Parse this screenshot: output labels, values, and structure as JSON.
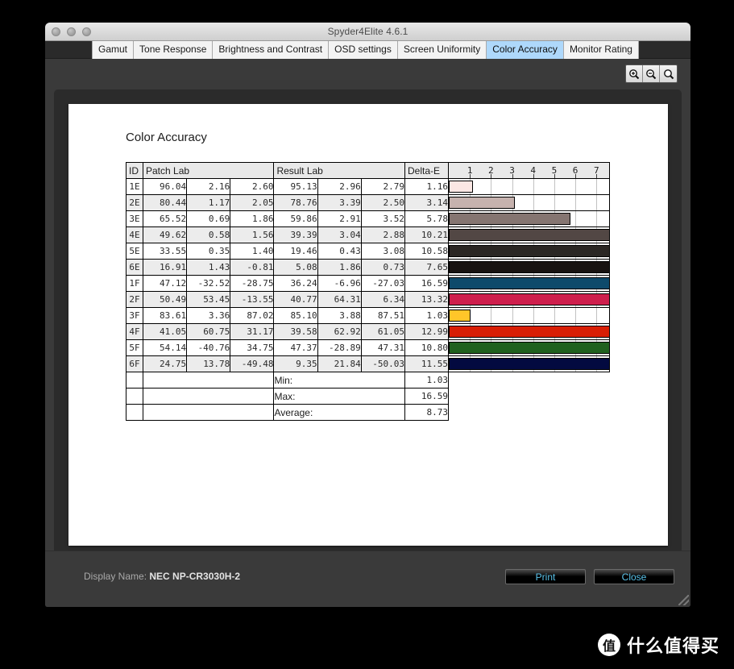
{
  "window": {
    "title": "Spyder4Elite 4.6.1",
    "traffic_lights": [
      "close-button",
      "minimize-button",
      "zoom-button"
    ]
  },
  "tabs": [
    {
      "label": "Gamut",
      "active": false
    },
    {
      "label": "Tone Response",
      "active": false
    },
    {
      "label": "Brightness and Contrast",
      "active": false
    },
    {
      "label": "OSD settings",
      "active": false
    },
    {
      "label": "Screen Uniformity",
      "active": false
    },
    {
      "label": "Color Accuracy",
      "active": true
    },
    {
      "label": "Monitor Rating",
      "active": false
    }
  ],
  "toolbar": {
    "zoom_in_icon": "zoom-in-icon",
    "zoom_out_icon": "zoom-out-icon",
    "zoom_reset_icon": "magnifier-icon"
  },
  "report": {
    "title": "Color Accuracy",
    "headers": {
      "id": "ID",
      "patch_lab": "Patch Lab",
      "result_lab": "Result Lab",
      "delta_e": "Delta-E"
    },
    "scale_ticks": [
      "1",
      "2",
      "3",
      "4",
      "5",
      "6",
      "7"
    ],
    "scale_max": 7.6,
    "rows": [
      {
        "id": "1E",
        "patch": [
          "96.04",
          "2.16",
          "2.60"
        ],
        "result": [
          "95.13",
          "2.96",
          "2.79"
        ],
        "delta_e": "1.16",
        "bar_value": 1.16,
        "color": "#fbe7e4"
      },
      {
        "id": "2E",
        "patch": [
          "80.44",
          "1.17",
          "2.05"
        ],
        "result": [
          "78.76",
          "3.39",
          "2.50"
        ],
        "delta_e": "3.14",
        "bar_value": 3.14,
        "color": "#c6b2ae"
      },
      {
        "id": "3E",
        "patch": [
          "65.52",
          "0.69",
          "1.86"
        ],
        "result": [
          "59.86",
          "2.91",
          "3.52"
        ],
        "delta_e": "5.78",
        "bar_value": 5.78,
        "color": "#857571"
      },
      {
        "id": "4E",
        "patch": [
          "49.62",
          "0.58",
          "1.56"
        ],
        "result": [
          "39.39",
          "3.04",
          "2.88"
        ],
        "delta_e": "10.21",
        "bar_value": 10.21,
        "color": "#524744"
      },
      {
        "id": "5E",
        "patch": [
          "33.55",
          "0.35",
          "1.40"
        ],
        "result": [
          "19.46",
          "0.43",
          "3.08"
        ],
        "delta_e": "10.58",
        "bar_value": 10.58,
        "color": "#2b2724"
      },
      {
        "id": "6E",
        "patch": [
          "16.91",
          "1.43",
          "-0.81"
        ],
        "result": [
          "5.08",
          "1.86",
          "0.73"
        ],
        "delta_e": "7.65",
        "bar_value": 7.65,
        "color": "#181311"
      },
      {
        "id": "1F",
        "patch": [
          "47.12",
          "-32.52",
          "-28.75"
        ],
        "result": [
          "36.24",
          "-6.96",
          "-27.03"
        ],
        "delta_e": "16.59",
        "bar_value": 16.59,
        "color": "#0e4a6b"
      },
      {
        "id": "2F",
        "patch": [
          "50.49",
          "53.45",
          "-13.55"
        ],
        "result": [
          "40.77",
          "64.31",
          "6.34"
        ],
        "delta_e": "13.32",
        "bar_value": 13.32,
        "color": "#ce1f4d"
      },
      {
        "id": "3F",
        "patch": [
          "83.61",
          "3.36",
          "87.02"
        ],
        "result": [
          "85.10",
          "3.88",
          "87.51"
        ],
        "delta_e": "1.03",
        "bar_value": 1.03,
        "color": "#ffc629"
      },
      {
        "id": "4F",
        "patch": [
          "41.05",
          "60.75",
          "31.17"
        ],
        "result": [
          "39.58",
          "62.92",
          "61.05"
        ],
        "delta_e": "12.99",
        "bar_value": 12.99,
        "color": "#d81e05"
      },
      {
        "id": "5F",
        "patch": [
          "54.14",
          "-40.76",
          "34.75"
        ],
        "result": [
          "47.37",
          "-28.89",
          "47.31"
        ],
        "delta_e": "10.80",
        "bar_value": 10.8,
        "color": "#20611f"
      },
      {
        "id": "6F",
        "patch": [
          "24.75",
          "13.78",
          "-49.48"
        ],
        "result": [
          "9.35",
          "21.84",
          "-50.03"
        ],
        "delta_e": "11.55",
        "bar_value": 11.55,
        "color": "#030a40"
      }
    ],
    "summary": [
      {
        "label": "Min:",
        "value": "1.03"
      },
      {
        "label": "Max:",
        "value": "16.59"
      },
      {
        "label": "Average:",
        "value": "8.73"
      }
    ]
  },
  "footer": {
    "display_name_label": "Display Name:",
    "display_name_value": "NEC NP-CR3030H-2",
    "print_label": "Print",
    "close_label": "Close"
  },
  "watermark": {
    "badge": "值",
    "text": "什么值得买"
  },
  "chart_data": {
    "type": "bar",
    "title": "Color Accuracy",
    "xlabel": "Delta-E",
    "ylabel": "Patch ID",
    "categories": [
      "1E",
      "2E",
      "3E",
      "4E",
      "5E",
      "6E",
      "1F",
      "2F",
      "3F",
      "4F",
      "5F",
      "6F"
    ],
    "values": [
      1.16,
      3.14,
      5.78,
      10.21,
      10.58,
      7.65,
      16.59,
      13.32,
      1.03,
      12.99,
      10.8,
      11.55
    ],
    "xlim": [
      0,
      7.6
    ],
    "tick_labels": [
      "1",
      "2",
      "3",
      "4",
      "5",
      "6",
      "7"
    ],
    "grid": true,
    "legend": "none",
    "note": "Bars are clipped at the right edge of the plot; values above ~7.6 extend past the last gridline.",
    "summary": {
      "min": 1.03,
      "max": 16.59,
      "average": 8.73
    }
  }
}
